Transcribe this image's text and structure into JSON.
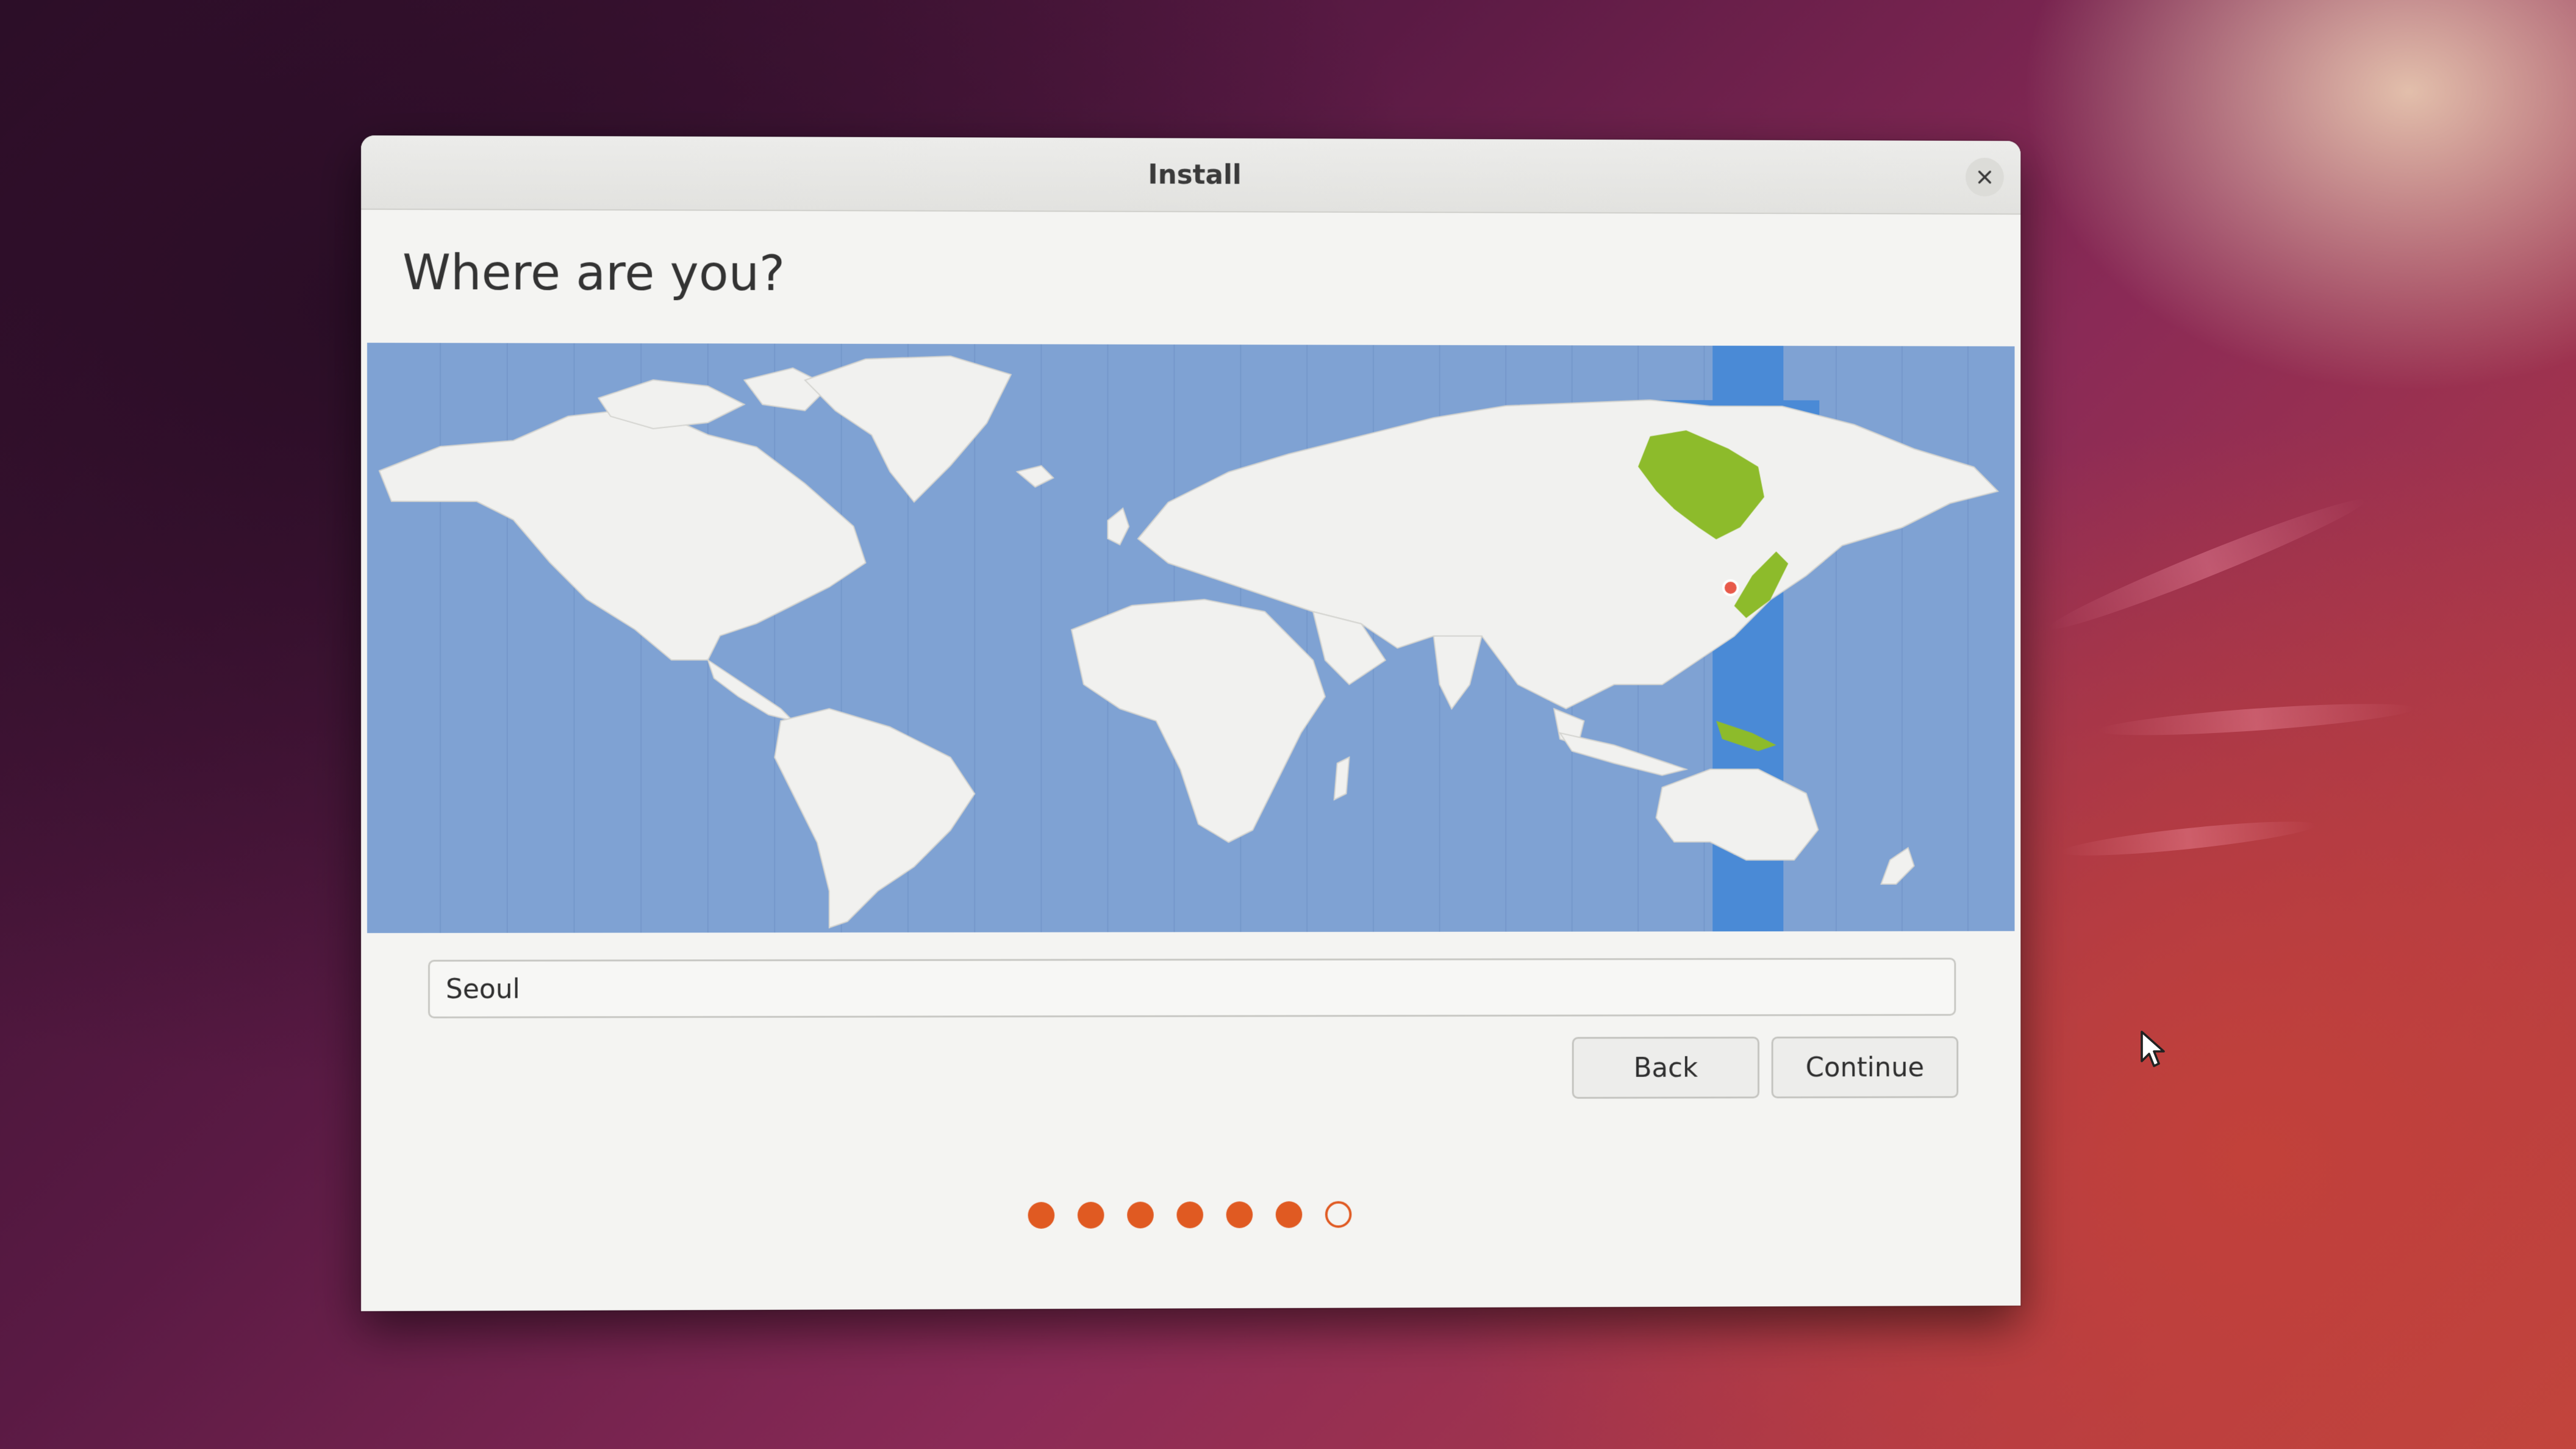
{
  "window": {
    "title": "Install",
    "close_icon": "close-icon"
  },
  "page": {
    "heading": "Where are you?"
  },
  "map": {
    "selected_city": "Seoul",
    "highlight_color": "#8dbb2b",
    "timezone_band_color": "#4a8ad6",
    "ocean_color": "#7fa2d3",
    "land_color": "#f1f1ef",
    "marker_color": "#e85a4a"
  },
  "location": {
    "value": "Seoul"
  },
  "buttons": {
    "back": "Back",
    "continue": "Continue"
  },
  "progress": {
    "total_steps": 7,
    "completed_steps": 6,
    "accent_color": "#e05a22"
  },
  "colors": {
    "accent": "#e05a22",
    "window_bg": "#f4f4f2"
  }
}
